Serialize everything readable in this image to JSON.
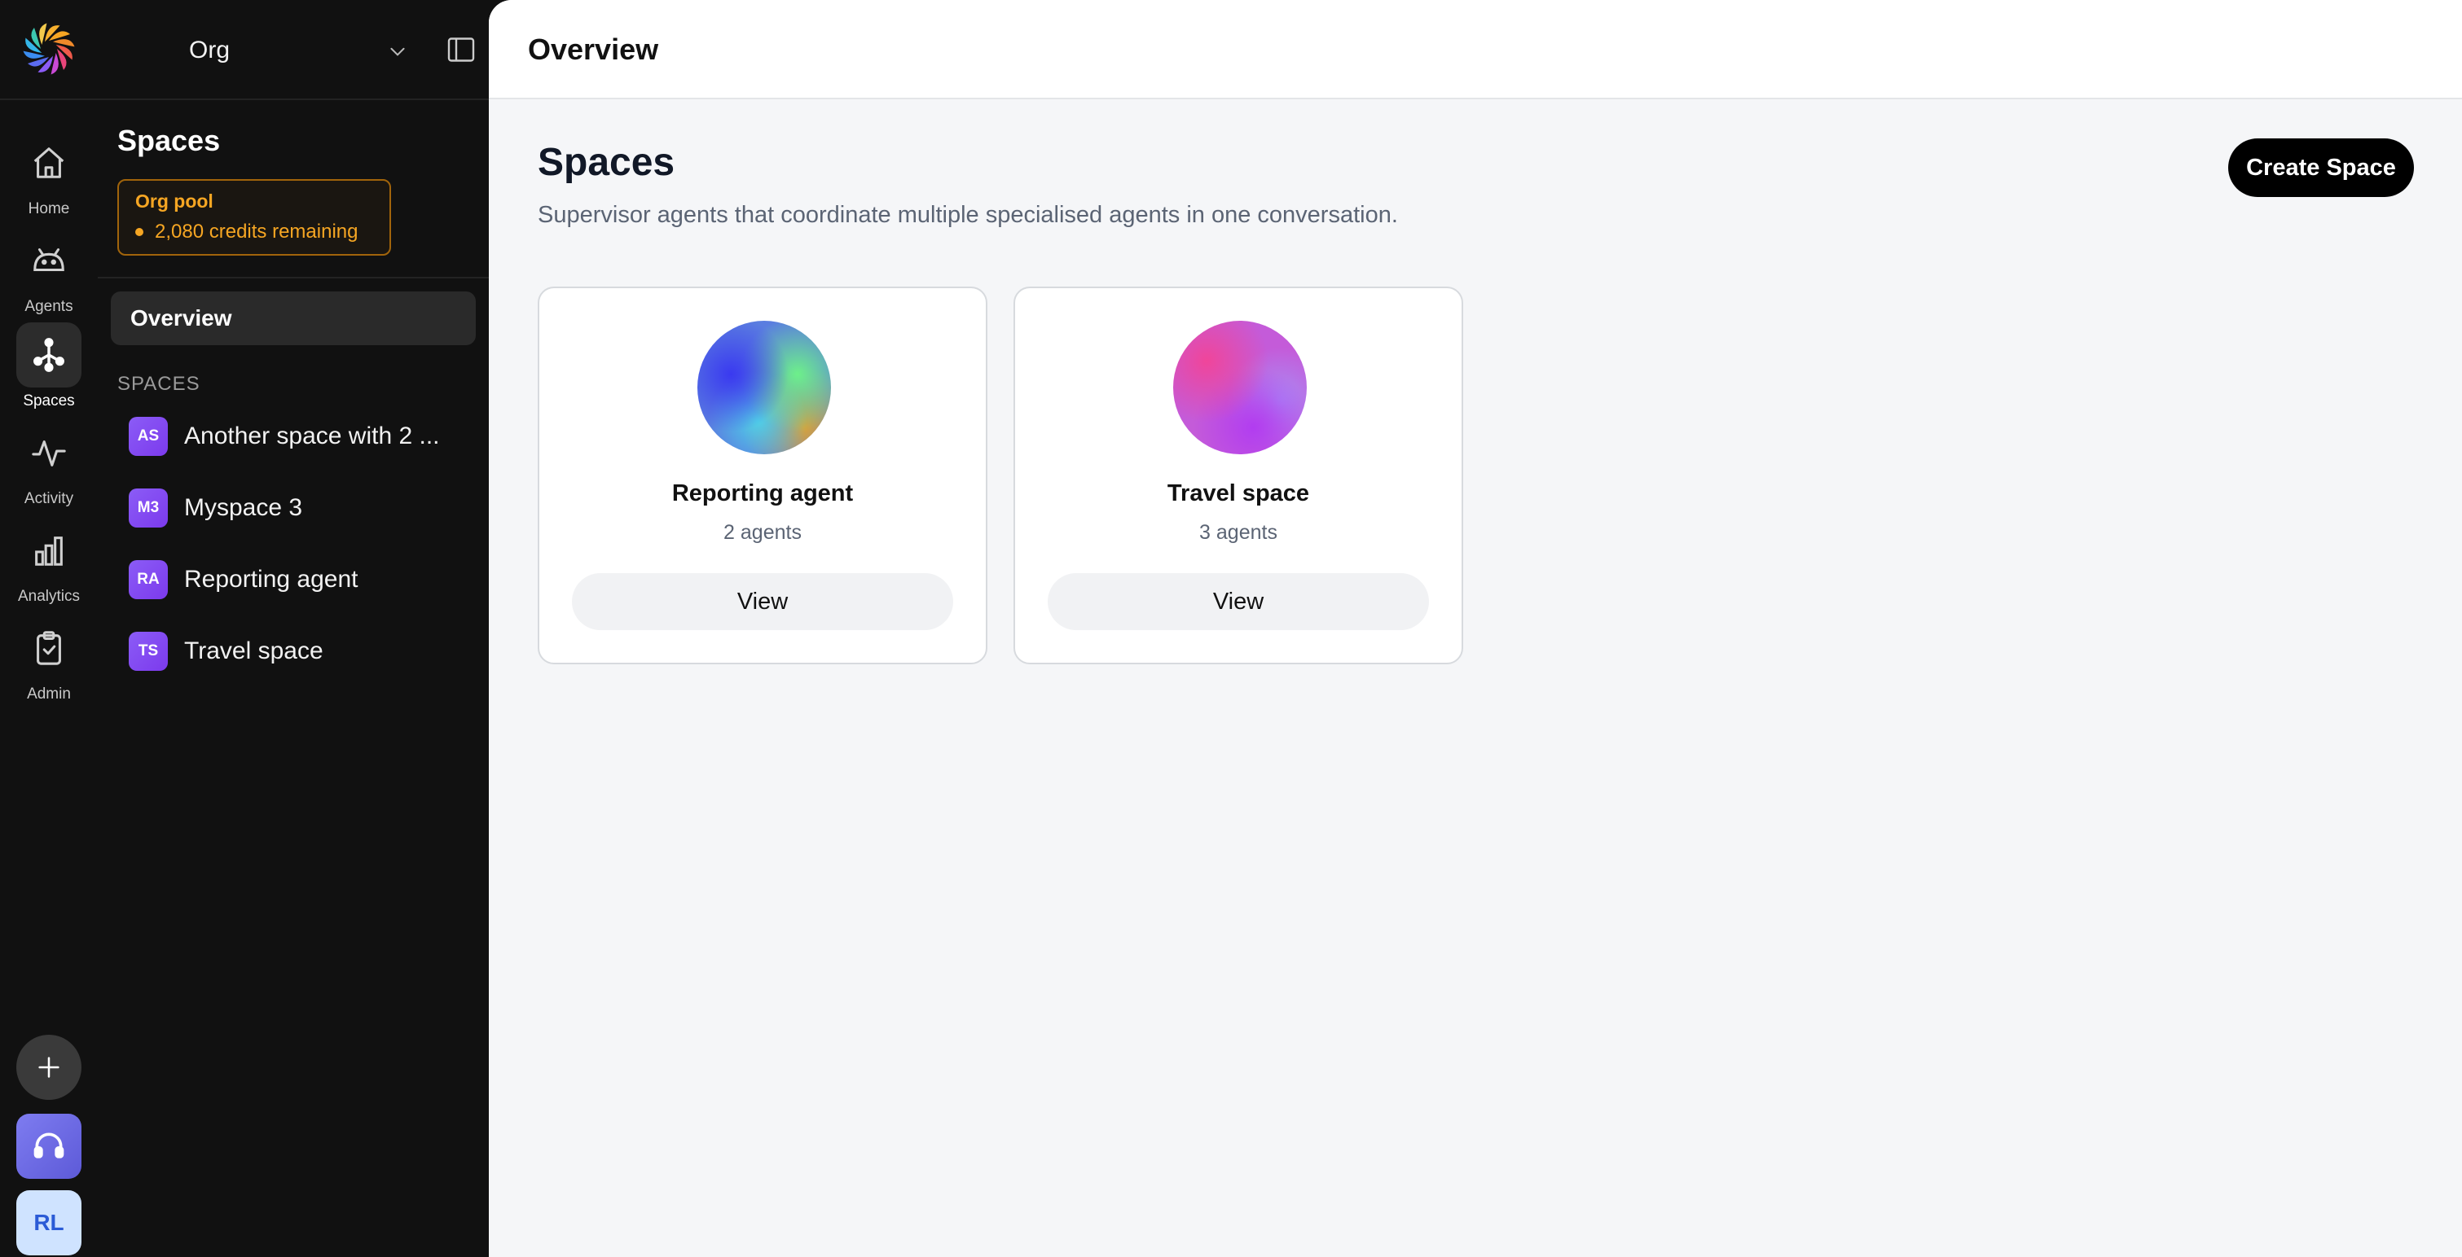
{
  "org": {
    "name": "Org"
  },
  "nav": [
    {
      "label": "Home",
      "icon": "home-icon"
    },
    {
      "label": "Agents",
      "icon": "robot-icon"
    },
    {
      "label": "Spaces",
      "icon": "spaces-icon",
      "active": true
    },
    {
      "label": "Activity",
      "icon": "activity-icon"
    },
    {
      "label": "Analytics",
      "icon": "bar-chart-icon"
    },
    {
      "label": "Admin",
      "icon": "clipboard-check-icon"
    }
  ],
  "user": {
    "initials": "RL"
  },
  "sidebar": {
    "title": "Spaces",
    "pool": {
      "title": "Org pool",
      "credits": "2,080 credits remaining",
      "color": "#f6a623"
    },
    "overview_label": "Overview",
    "section_label": "SPACES",
    "spaces": [
      {
        "badge": "AS",
        "label": "Another space with 2 ..."
      },
      {
        "badge": "M3",
        "label": "Myspace 3"
      },
      {
        "badge": "RA",
        "label": "Reporting agent"
      },
      {
        "badge": "TS",
        "label": "Travel space"
      }
    ]
  },
  "main": {
    "topbar_title": "Overview",
    "title": "Spaces",
    "subtitle": "Supervisor agents that coordinate multiple specialised agents in one conversation.",
    "create_label": "Create Space",
    "cards": [
      {
        "name": "Reporting agent",
        "count": "2 agents",
        "view_label": "View"
      },
      {
        "name": "Travel space",
        "count": "3 agents",
        "view_label": "View"
      }
    ]
  }
}
